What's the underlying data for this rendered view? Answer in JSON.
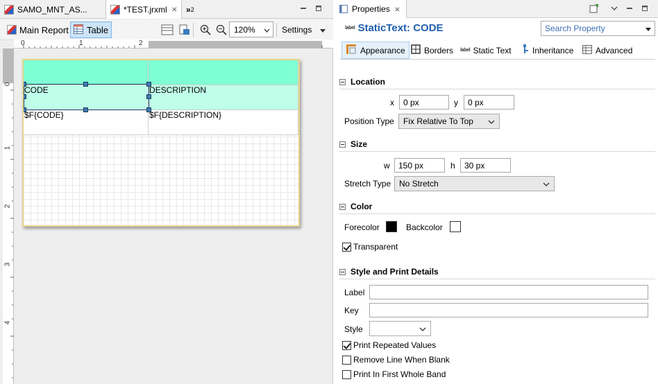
{
  "editor": {
    "tabs": [
      {
        "label": "SAMO_MNT_AS..."
      },
      {
        "label": "*TEST.jrxml",
        "close": "⨯"
      }
    ],
    "overflow": "»",
    "overflow_count": "2",
    "toolbar": {
      "main_report": "Main Report",
      "table": "Table",
      "zoom": "120%",
      "settings": "Settings"
    },
    "ruler": {
      "h": [
        "0",
        "1",
        "2"
      ],
      "v": [
        "0",
        "1",
        "2",
        "3",
        "4"
      ]
    },
    "table": {
      "header_row": [
        "",
        ""
      ],
      "column_row": [
        "CODE",
        "DESCRIPTION"
      ],
      "detail_row": [
        "$F{CODE}",
        "$F{DESCRIPTION}"
      ]
    }
  },
  "properties": {
    "tab_label": "Properties",
    "tab_close": "⨯",
    "element_label_icon": "label",
    "title": "StaticText: CODE",
    "search_placeholder": "Search Property",
    "tabs": [
      "Appearance",
      "Borders",
      "Static Text",
      "Inheritance",
      "Advanced"
    ],
    "location": {
      "section": "Location",
      "x_label": "x",
      "x_value": "0 px",
      "y_label": "y",
      "y_value": "0 px",
      "position_type_label": "Position Type",
      "position_type_value": "Fix Relative To Top"
    },
    "size": {
      "section": "Size",
      "w_label": "w",
      "w_value": "150 px",
      "h_label": "h",
      "h_value": "30 px",
      "stretch_type_label": "Stretch Type",
      "stretch_type_value": "No Stretch"
    },
    "color": {
      "section": "Color",
      "forecolor_label": "Forecolor",
      "forecolor": "#000000",
      "backcolor_label": "Backcolor",
      "backcolor": "#ffffff",
      "transparent_label": "Transparent",
      "transparent": true
    },
    "style_print": {
      "section": "Style and Print Details",
      "label_label": "Label",
      "label_value": "",
      "key_label": "Key",
      "key_value": "",
      "style_label": "Style",
      "style_value": "",
      "print_repeated_label": "Print Repeated Values",
      "print_repeated": true,
      "remove_line_label": "Remove Line When Blank",
      "remove_line": false,
      "print_first_band_label": "Print In First Whole Band",
      "print_first_band": false
    }
  },
  "colors": {
    "table_header_fill": "#7fffd4",
    "table_column_fill": "#bfffe9",
    "accent_title": "#1f5fb0",
    "selection_handle": "#3d7bb0"
  }
}
